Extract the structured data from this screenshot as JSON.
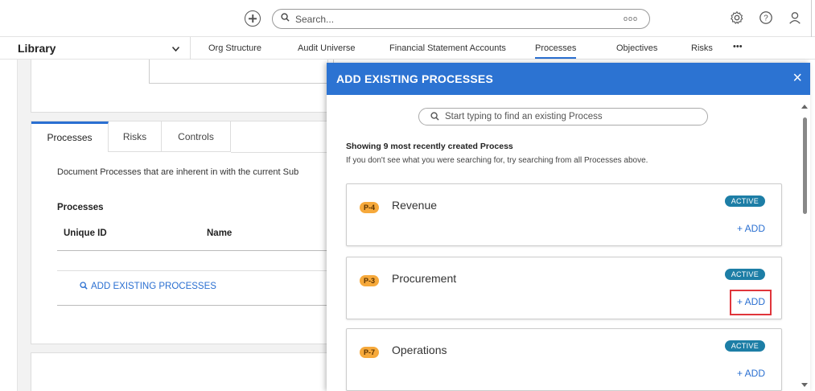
{
  "topbar": {
    "search_placeholder": "Search...",
    "more_label": "ooo",
    "icons": [
      "plus-circle-icon",
      "search-icon",
      "gear-icon",
      "help-icon",
      "user-icon"
    ]
  },
  "nav": {
    "library": "Library",
    "items": [
      "Org Structure",
      "Audit Universe",
      "Financial Statement Accounts",
      "Processes",
      "Objectives",
      "Risks",
      "•••"
    ],
    "active": "Processes"
  },
  "left": {
    "tabs": [
      "Processes",
      "Risks",
      "Controls"
    ],
    "description": "Document Processes that are inherent in with the current Sub",
    "section_title": "Processes",
    "col_unique_id": "Unique ID",
    "col_name": "Name",
    "add_existing": "ADD EXISTING PROCESSES"
  },
  "modal": {
    "title": "ADD EXISTING PROCESSES",
    "close": "×",
    "search_placeholder": "Start typing to find an existing Process",
    "showing": "Showing 9 most recently created Process",
    "hint": "If you don't see what you were searching for, try searching from all Processes above.",
    "processes": [
      {
        "id": "P-4",
        "name": "Revenue",
        "status": "ACTIVE",
        "action": "+ ADD"
      },
      {
        "id": "P-3",
        "name": "Procurement",
        "status": "ACTIVE",
        "action": "+ ADD"
      },
      {
        "id": "P-7",
        "name": "Operations",
        "status": "ACTIVE",
        "action": "+ ADD"
      }
    ]
  },
  "colors": {
    "accent": "#2c73d2",
    "badge_orange": "#f6a93b",
    "active_badge": "#1d7ea6",
    "highlight": "#e0353b"
  }
}
